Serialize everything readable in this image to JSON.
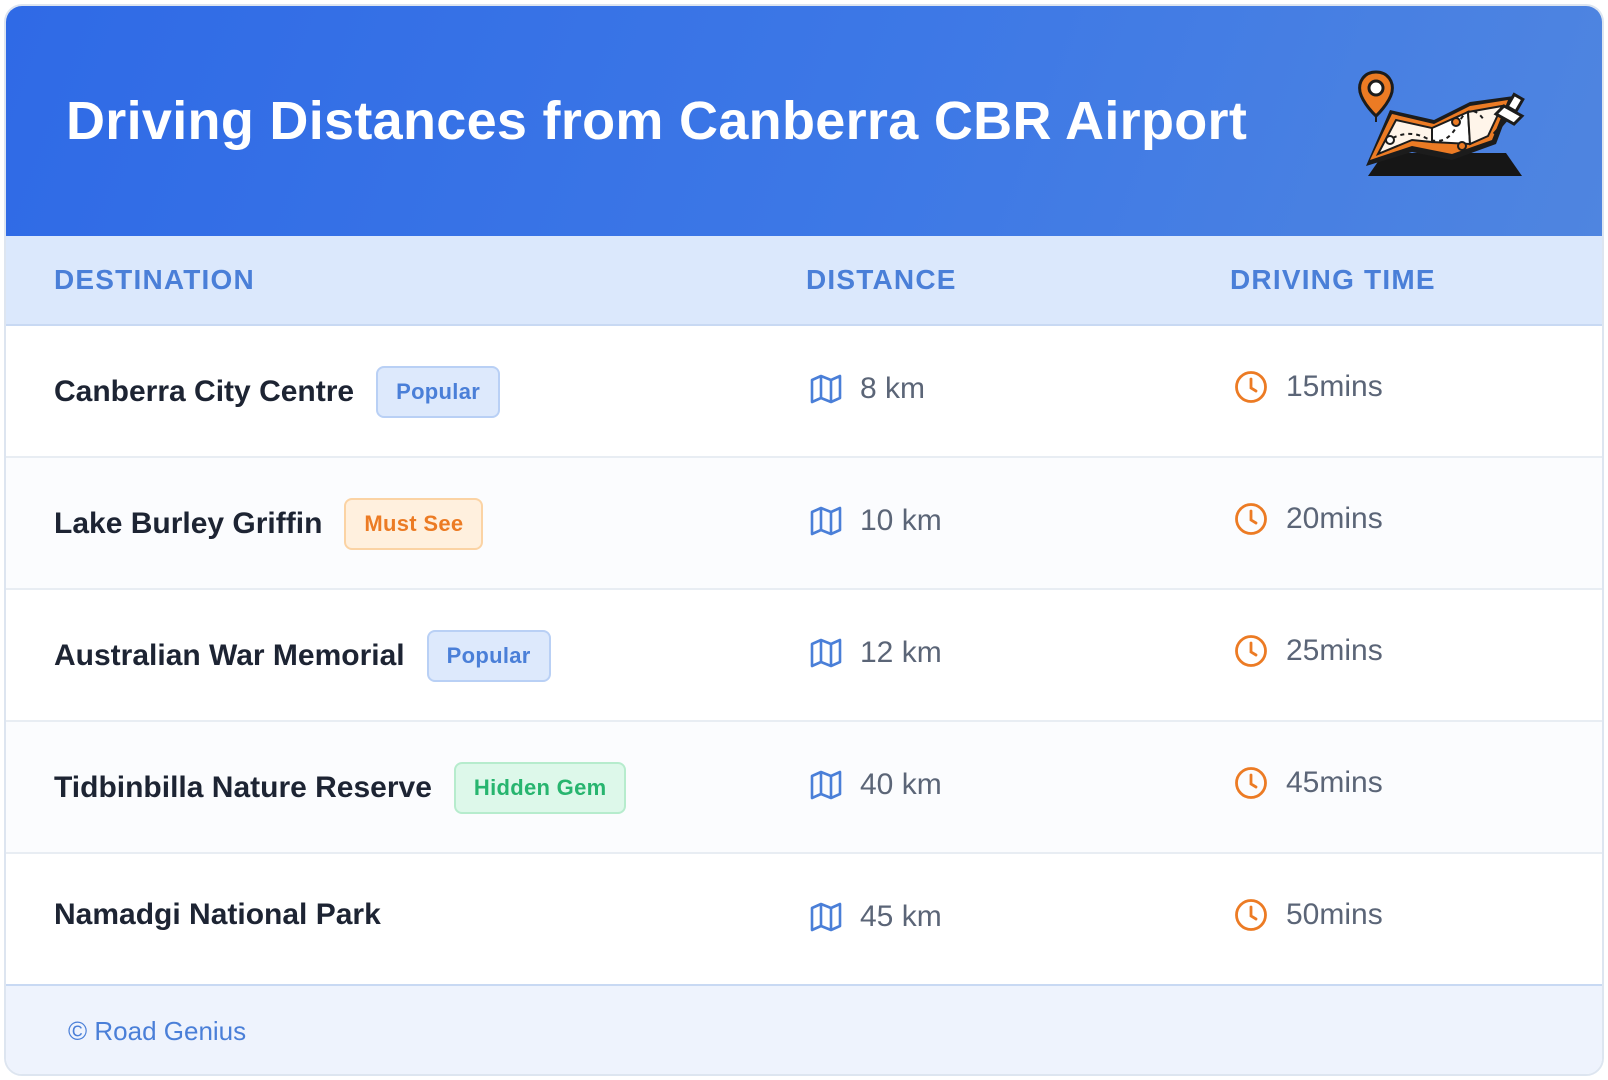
{
  "header": {
    "title": "Driving Distances from Canberra CBR Airport",
    "illustration_icon": "map-with-pin-icon"
  },
  "columns": {
    "destination": "DESTINATION",
    "distance": "DISTANCE",
    "driving_time": "DRIVING TIME"
  },
  "rows": [
    {
      "destination": "Canberra City Centre",
      "badge": "Popular",
      "badge_color": "#4a7fd8",
      "distance": "8 km",
      "time": "15mins"
    },
    {
      "destination": "Lake Burley Griffin",
      "badge": "Must See",
      "badge_color": "#ec7b24",
      "distance": "10 km",
      "time": "20mins"
    },
    {
      "destination": "Australian War Memorial",
      "badge": "Popular",
      "badge_color": "#4a7fd8",
      "distance": "12 km",
      "time": "25mins"
    },
    {
      "destination": "Tidbinbilla Nature Reserve",
      "badge": "Hidden Gem",
      "badge_color": "#27b56f",
      "distance": "40 km",
      "time": "45mins"
    },
    {
      "destination": "Namadgi National Park",
      "badge": "",
      "badge_color": "",
      "distance": "45 km",
      "time": "50mins"
    }
  ],
  "icons": {
    "distance": "map-icon",
    "time": "clock-icon"
  },
  "colors": {
    "header_start": "#2f6ae6",
    "accent_blue": "#4a7fd8",
    "accent_orange": "#ec7b24",
    "accent_green": "#27b56f"
  },
  "footer": {
    "credit": "© Road Genius"
  }
}
